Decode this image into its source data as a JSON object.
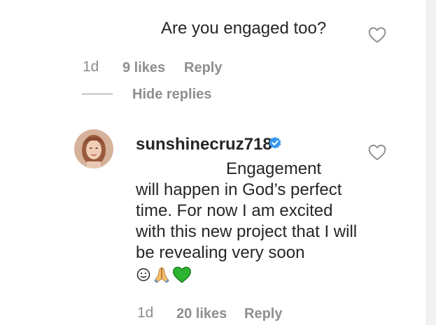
{
  "comment1": {
    "text": "Are you engaged too?",
    "time": "1d",
    "likes": "9 likes",
    "reply_label": "Reply",
    "hide_replies_label": "Hide replies"
  },
  "reply1": {
    "username": "sunshinecruz718",
    "text_line1": "Engagement",
    "text_rest": "will happen in God’s perfect time. For now I am excited with this new project that I will be revealing very soon",
    "emojis": [
      "smiling-face-emoji",
      "folded-hands-emoji",
      "green-heart-emoji"
    ],
    "time": "1d",
    "likes": "20 likes",
    "reply_label": "Reply"
  },
  "colors": {
    "text": "#262626",
    "meta": "#8e8e8e",
    "verified": "#3897f0",
    "green_heart": "#2bb531"
  }
}
